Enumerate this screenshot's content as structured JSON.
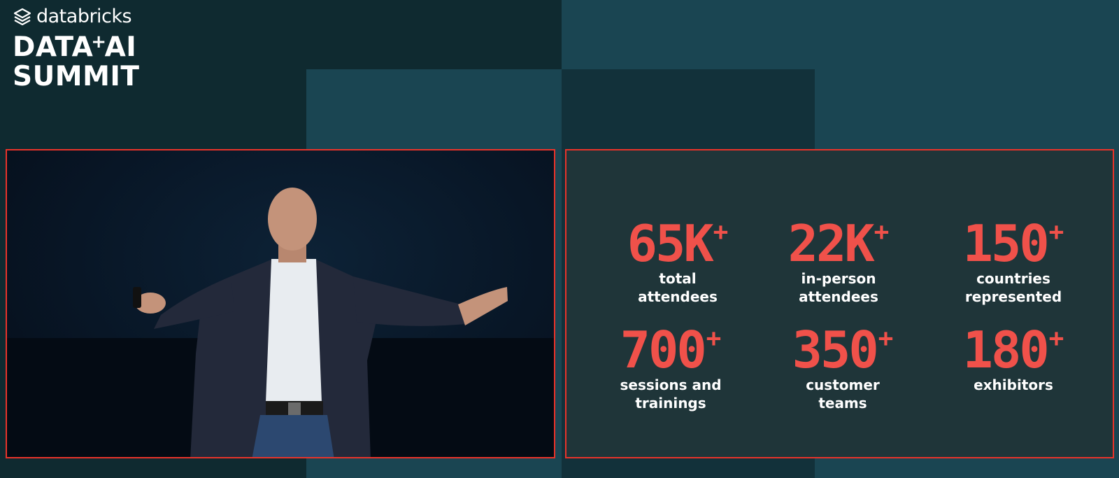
{
  "logo": {
    "brand": "databricks",
    "line1_part1": "DATA",
    "line1_plus": "+",
    "line1_part2": "AI",
    "line2": "SUMMIT"
  },
  "stats": [
    {
      "value": "65K",
      "suffix": "+",
      "label_line1": "total",
      "label_line2": "attendees"
    },
    {
      "value": "22K",
      "suffix": "+",
      "label_line1": "in-person",
      "label_line2": "attendees"
    },
    {
      "value": "150",
      "suffix": "+",
      "label_line1": "countries",
      "label_line2": "represented"
    },
    {
      "value": "700",
      "suffix": "+",
      "label_line1": "sessions and",
      "label_line2": "trainings"
    },
    {
      "value": "350",
      "suffix": "+",
      "label_line1": "customer",
      "label_line2": "teams"
    },
    {
      "value": "180",
      "suffix": "+",
      "label_line1": "exhibitors",
      "label_line2": ""
    }
  ],
  "colors": {
    "accent_red": "#e8332a",
    "stat_value": "#f0514a",
    "background_dark": "#0f2a30",
    "background_teal": "#1a4552",
    "panel": "#1f3539"
  }
}
